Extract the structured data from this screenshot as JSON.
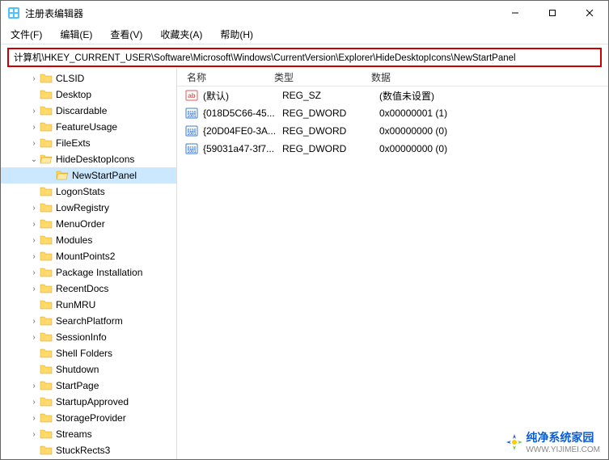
{
  "title": "注册表编辑器",
  "menu": [
    "文件(F)",
    "编辑(E)",
    "查看(V)",
    "收藏夹(A)",
    "帮助(H)"
  ],
  "address": "计算机\\HKEY_CURRENT_USER\\Software\\Microsoft\\Windows\\CurrentVersion\\Explorer\\HideDesktopIcons\\NewStartPanel",
  "tree": [
    {
      "label": "CLSID",
      "indent": 48,
      "exp": "›"
    },
    {
      "label": "Desktop",
      "indent": 48,
      "exp": ""
    },
    {
      "label": "Discardable",
      "indent": 48,
      "exp": "›"
    },
    {
      "label": "FeatureUsage",
      "indent": 48,
      "exp": "›"
    },
    {
      "label": "FileExts",
      "indent": 48,
      "exp": "›"
    },
    {
      "label": "HideDesktopIcons",
      "indent": 48,
      "exp": "⌄",
      "selectedParent": true
    },
    {
      "label": "NewStartPanel",
      "indent": 68,
      "exp": "",
      "selected": true
    },
    {
      "label": "LogonStats",
      "indent": 48,
      "exp": ""
    },
    {
      "label": "LowRegistry",
      "indent": 48,
      "exp": "›"
    },
    {
      "label": "MenuOrder",
      "indent": 48,
      "exp": "›"
    },
    {
      "label": "Modules",
      "indent": 48,
      "exp": "›"
    },
    {
      "label": "MountPoints2",
      "indent": 48,
      "exp": "›"
    },
    {
      "label": "Package Installation",
      "indent": 48,
      "exp": "›"
    },
    {
      "label": "RecentDocs",
      "indent": 48,
      "exp": "›"
    },
    {
      "label": "RunMRU",
      "indent": 48,
      "exp": ""
    },
    {
      "label": "SearchPlatform",
      "indent": 48,
      "exp": "›"
    },
    {
      "label": "SessionInfo",
      "indent": 48,
      "exp": "›"
    },
    {
      "label": "Shell Folders",
      "indent": 48,
      "exp": ""
    },
    {
      "label": "Shutdown",
      "indent": 48,
      "exp": ""
    },
    {
      "label": "StartPage",
      "indent": 48,
      "exp": "›"
    },
    {
      "label": "StartupApproved",
      "indent": 48,
      "exp": "›"
    },
    {
      "label": "StorageProvider",
      "indent": 48,
      "exp": "›"
    },
    {
      "label": "Streams",
      "indent": 48,
      "exp": "›"
    },
    {
      "label": "StuckRects3",
      "indent": 48,
      "exp": ""
    }
  ],
  "columns": {
    "name": "名称",
    "type": "类型",
    "data": "数据"
  },
  "values": [
    {
      "icon": "string",
      "name": "(默认)",
      "type": "REG_SZ",
      "data": "(数值未设置)"
    },
    {
      "icon": "dword",
      "name": "{018D5C66-45...",
      "type": "REG_DWORD",
      "data": "0x00000001 (1)"
    },
    {
      "icon": "dword",
      "name": "{20D04FE0-3A...",
      "type": "REG_DWORD",
      "data": "0x00000000 (0)"
    },
    {
      "icon": "dword",
      "name": "{59031a47-3f7...",
      "type": "REG_DWORD",
      "data": "0x00000000 (0)"
    }
  ],
  "watermark": {
    "main": "纯净系统家园",
    "sub": "WWW.YIJIMEI.COM"
  }
}
